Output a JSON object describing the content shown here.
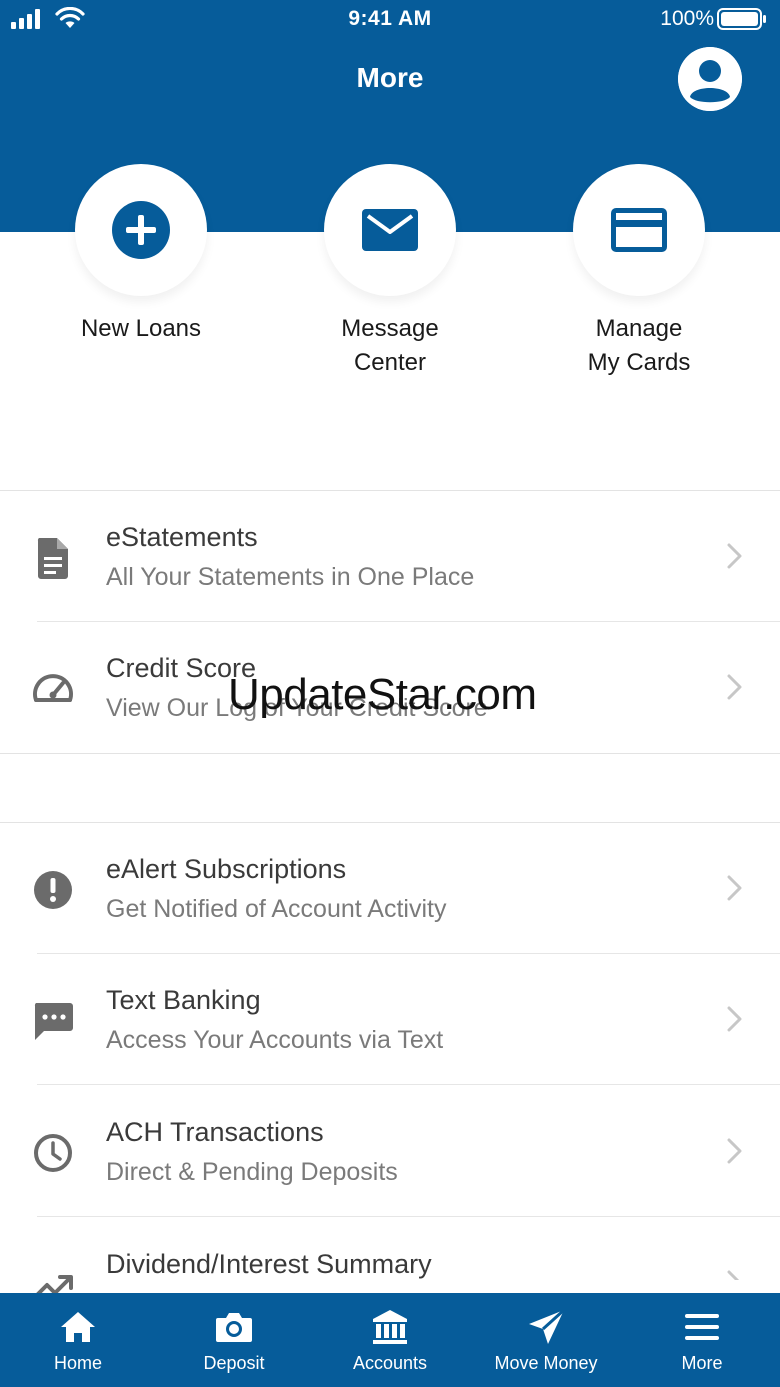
{
  "status": {
    "time": "9:41 AM",
    "battery": "100%"
  },
  "header": {
    "title": "More"
  },
  "quick_actions": [
    {
      "label_lines": [
        "New Loans"
      ]
    },
    {
      "label_lines": [
        "Message",
        "Center"
      ]
    },
    {
      "label_lines": [
        "Manage",
        "My Cards"
      ]
    }
  ],
  "sections": [
    [
      {
        "title": "eStatements",
        "subtitle": "All Your Statements in One Place",
        "icon": "document-icon"
      },
      {
        "title": "Credit Score",
        "subtitle": "View Our Log of Your Credit Score",
        "icon": "speedometer-icon"
      }
    ],
    [
      {
        "title": "eAlert Subscriptions",
        "subtitle": "Get Notified of Account Activity",
        "icon": "alert-icon"
      },
      {
        "title": "Text Banking",
        "subtitle": "Access Your Accounts via Text",
        "icon": "chat-icon"
      },
      {
        "title": "ACH Transactions",
        "subtitle": "Direct & Pending Deposits",
        "icon": "clock-icon"
      },
      {
        "title": "Dividend/Interest Summary",
        "subtitle": "",
        "icon": "trending-up-icon"
      }
    ]
  ],
  "watermark": "UpdateStar.com",
  "tabs": [
    {
      "label": "Home",
      "icon": "home-icon"
    },
    {
      "label": "Deposit",
      "icon": "camera-icon"
    },
    {
      "label": "Accounts",
      "icon": "bank-icon"
    },
    {
      "label": "Move Money",
      "icon": "send-icon"
    },
    {
      "label": "More",
      "icon": "menu-icon"
    }
  ],
  "colors": {
    "brand": "#065c9a",
    "icon_gray": "#6b6b6b",
    "chevron": "#c7c7c7"
  }
}
